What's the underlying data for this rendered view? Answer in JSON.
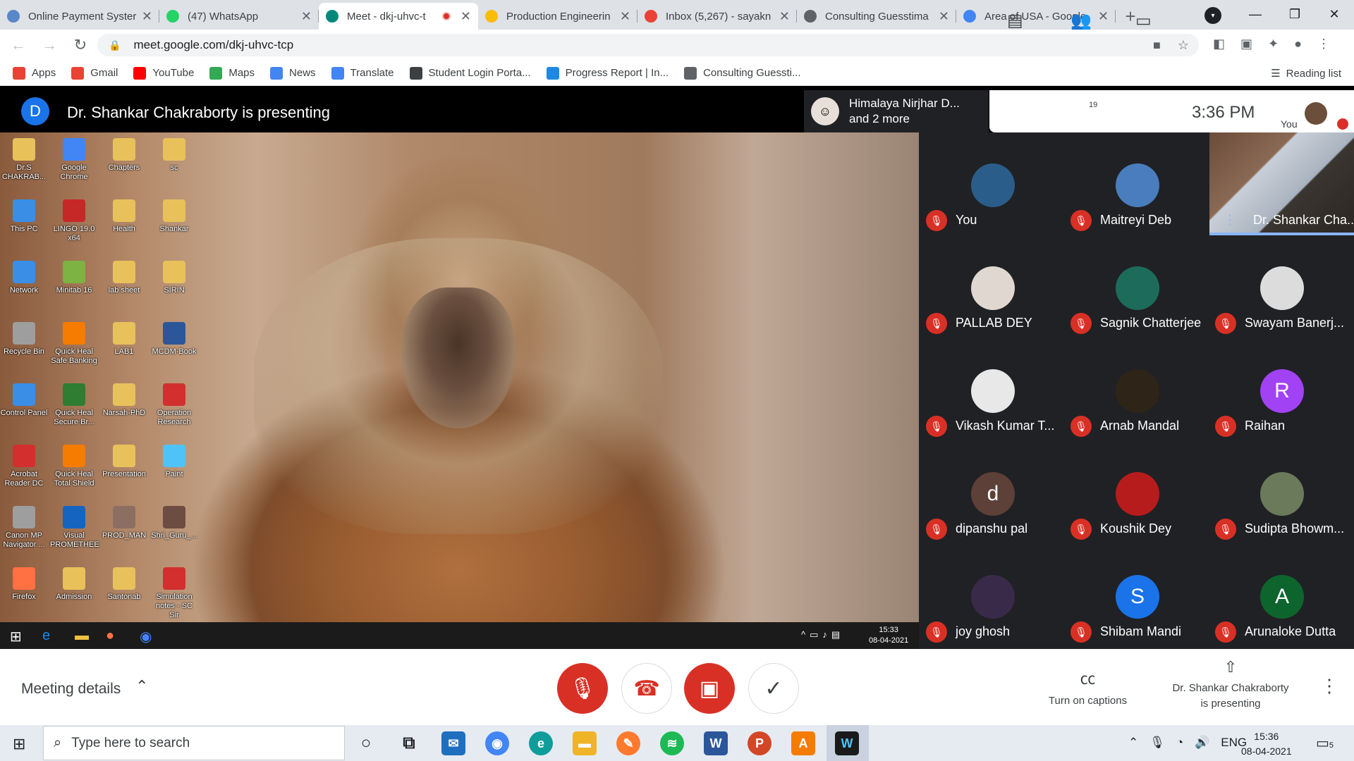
{
  "browser": {
    "tabs": [
      {
        "title": "Online Payment Syster",
        "favicon_color": "#5a87c8",
        "active": false
      },
      {
        "title": "(47) WhatsApp",
        "favicon_color": "#25d366",
        "active": false
      },
      {
        "title": "Meet - dkj-uhvc-t",
        "favicon_color": "#00897b",
        "active": true,
        "recording": true
      },
      {
        "title": "Production Engineerin",
        "favicon_color": "#fbbc04",
        "active": false
      },
      {
        "title": "Inbox (5,267) - sayakn",
        "favicon_color": "#ea4335",
        "active": false
      },
      {
        "title": "Consulting Guesstima",
        "favicon_color": "#5f6368",
        "active": false
      },
      {
        "title": "Area of USA - Google",
        "favicon_color": "#4285f4",
        "active": false
      }
    ],
    "url": "meet.google.com/dkj-uhvc-tcp",
    "bookmarks": [
      {
        "label": "Apps",
        "color": "#ea4335"
      },
      {
        "label": "Gmail",
        "color": "#ea4335"
      },
      {
        "label": "YouTube",
        "color": "#ff0000"
      },
      {
        "label": "Maps",
        "color": "#34a853"
      },
      {
        "label": "News",
        "color": "#4285f4"
      },
      {
        "label": "Translate",
        "color": "#4285f4"
      },
      {
        "label": "Student Login Porta...",
        "color": "#3c4043"
      },
      {
        "label": "Progress Report | In...",
        "color": "#1e88e5"
      },
      {
        "label": "Consulting Guessti...",
        "color": "#5f6368"
      }
    ],
    "reading_list": "Reading list"
  },
  "meet": {
    "presenter_initial": "D",
    "presenting_text": "Dr. Shankar Chakraborty is presenting",
    "speaker_chip": {
      "line1": "Himalaya Nirjhar D...",
      "line2": "and 2 more"
    },
    "people_count": "19",
    "clock": "3:36 PM",
    "you_label": "You",
    "participants": [
      {
        "name": "You",
        "avatar_color": "#2b5d8a",
        "initial": ""
      },
      {
        "name": "Maitreyi Deb",
        "avatar_color": "#4a7dbd",
        "initial": ""
      },
      {
        "name": "Dr. Shankar Cha...",
        "video": true
      },
      {
        "name": "PALLAB DEY",
        "avatar_color": "#e0d8d0",
        "initial": ""
      },
      {
        "name": "Sagnik Chatterjee",
        "avatar_color": "#1d6b5a",
        "initial": ""
      },
      {
        "name": "Swayam Banerj...",
        "avatar_color": "#dcdcdc",
        "initial": ""
      },
      {
        "name": "Vikash Kumar T...",
        "avatar_color": "#e8e8e8",
        "initial": ""
      },
      {
        "name": "Arnab Mandal",
        "avatar_color": "#2e2418",
        "initial": ""
      },
      {
        "name": "Raihan",
        "avatar_color": "#a142f4",
        "initial": "R"
      },
      {
        "name": "dipanshu pal",
        "avatar_color": "#5d4037",
        "initial": "d"
      },
      {
        "name": "Koushik Dey",
        "avatar_color": "#b71c1c",
        "initial": ""
      },
      {
        "name": "Sudipta Bhowm...",
        "avatar_color": "#6a7a5a",
        "initial": ""
      },
      {
        "name": "joy ghosh",
        "avatar_color": "#3a2a4a",
        "initial": ""
      },
      {
        "name": "Shibam Mandi",
        "avatar_color": "#1a73e8",
        "initial": "S"
      },
      {
        "name": "Arunaloke Dutta",
        "avatar_color": "#0d652d",
        "initial": "A"
      }
    ],
    "meeting_details": "Meeting details",
    "captions_label": "Turn on captions",
    "presenting_label_line1": "Dr. Shankar Chakraborty",
    "presenting_label_line2": "is presenting"
  },
  "shared_desktop": {
    "icons": [
      {
        "label": "Dr.S CHAKRAB...",
        "color": "#e8c15a"
      },
      {
        "label": "Google Chrome",
        "color": "#4285f4"
      },
      {
        "label": "Chapters",
        "color": "#e8c15a"
      },
      {
        "label": "sc",
        "color": "#e8c15a"
      },
      {
        "label": "This PC",
        "color": "#3a8ee6"
      },
      {
        "label": "LINGO 19.0 x64",
        "color": "#c62828"
      },
      {
        "label": "Health",
        "color": "#e8c15a"
      },
      {
        "label": "Shankar",
        "color": "#e8c15a"
      },
      {
        "label": "Network",
        "color": "#3a8ee6"
      },
      {
        "label": "Minitab 16",
        "color": "#7cb342"
      },
      {
        "label": "lab sheet",
        "color": "#e8c15a"
      },
      {
        "label": "SIRIN",
        "color": "#e8c15a"
      },
      {
        "label": "Recycle Bin",
        "color": "#9e9e9e"
      },
      {
        "label": "Quick Heal Safe Banking",
        "color": "#f57c00"
      },
      {
        "label": "LAB1",
        "color": "#e8c15a"
      },
      {
        "label": "MCDM-Book",
        "color": "#2b579a"
      },
      {
        "label": "Control Panel",
        "color": "#3a8ee6"
      },
      {
        "label": "Quick Heal Secure Br...",
        "color": "#2e7d32"
      },
      {
        "label": "Narsah-PhD",
        "color": "#e8c15a"
      },
      {
        "label": "Operation Research",
        "color": "#d32f2f"
      },
      {
        "label": "Acrobat Reader DC",
        "color": "#d32f2f"
      },
      {
        "label": "Quick Heal Total Shield",
        "color": "#f57c00"
      },
      {
        "label": "Presentation",
        "color": "#e8c15a"
      },
      {
        "label": "Paint",
        "color": "#4fc3f7"
      },
      {
        "label": "Canon MP Navigator ...",
        "color": "#9e9e9e"
      },
      {
        "label": "Visual PROMETHEE",
        "color": "#1565c0"
      },
      {
        "label": "PROD_MAN",
        "color": "#8d6e63"
      },
      {
        "label": "Shri_Guru_...",
        "color": "#6d4c41"
      },
      {
        "label": "Firefox",
        "color": "#ff7043"
      },
      {
        "label": "Admission",
        "color": "#e8c15a"
      },
      {
        "label": "Santonab",
        "color": "#e8c15a"
      },
      {
        "label": "Simulation notes - SC Sir",
        "color": "#d32f2f"
      }
    ],
    "clock_time": "15:33",
    "clock_date": "08-04-2021"
  },
  "taskbar": {
    "search_placeholder": "Type here to search",
    "language": "ENG",
    "time": "15:36",
    "date": "08-04-2021",
    "notification_count": "5"
  }
}
